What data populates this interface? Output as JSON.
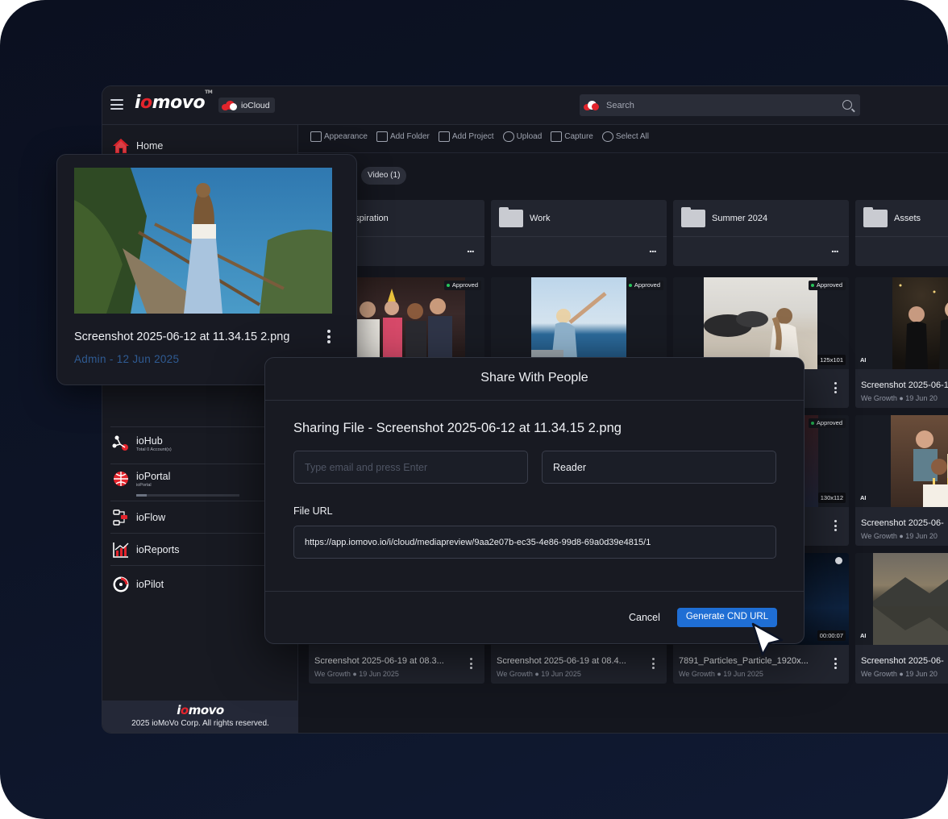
{
  "header": {
    "brand": "iomovo",
    "tm": "TM",
    "cloud_label": "ioCloud",
    "search_placeholder": "Search"
  },
  "sidebar": {
    "home": "Home",
    "items": [
      {
        "label": "ioHub",
        "sub": "Total 0 Account(s)"
      },
      {
        "label": "ioPortal",
        "sub": "ioPortal"
      },
      {
        "label": "ioFlow",
        "sub": ""
      },
      {
        "label": "ioReports",
        "sub": ""
      },
      {
        "label": "ioPilot",
        "sub": ""
      }
    ],
    "footer_brand": "iomovo",
    "copyright": "2025 ioMoVo Corp. All rights reserved."
  },
  "toolbar": [
    "Appearance",
    "Add Folder",
    "Add Project",
    "Upload",
    "Capture",
    "Select All"
  ],
  "filters": {
    "video": "Video (1)"
  },
  "folders": [
    "Inspiration",
    "Work",
    "Summer 2024",
    "Assets"
  ],
  "badge_approved": "Approved",
  "badge_ai": "AI",
  "cards": [
    {
      "title": "Screenshot 2025-06-19 at 08.3...",
      "owner": "We Growth",
      "date": "19 Jun 2025"
    },
    {
      "title": "Screenshot 2025-06-19 at 08.4...",
      "owner": "We Growth",
      "date": "19 Jun 2025"
    },
    {
      "title": "7891_Particles_Particle_1920x...",
      "owner": "We Growth",
      "date": "19 Jun 2025",
      "duration": "00:00:07"
    },
    {
      "title": "Screenshot 2025-06-1",
      "owner": "We Growth",
      "date": "19 Jun 20"
    },
    {
      "title": "Screenshot 2025-06-",
      "owner": "We Growth",
      "date": "19 Jun 20"
    },
    {
      "title": "Screenshot 2025-06-",
      "owner": "We Growth",
      "date": "19 Jun 20"
    }
  ],
  "dims": [
    "125x101",
    "130x112"
  ],
  "ellipsis": "...",
  "preview": {
    "filename": "Screenshot 2025-06-12 at 11.34.15 2.png",
    "owner": "Admin",
    "sep": "-",
    "date": "12 Jun 2025"
  },
  "modal": {
    "title": "Share With People",
    "subtitle": "Sharing File - Screenshot 2025-06-12 at 11.34.15 2.png",
    "email_placeholder": "Type email and press Enter",
    "role": "Reader",
    "url_label": "File URL",
    "url": "https://app.iomovo.io/i/cloud/mediapreview/9aa2e07b-ec35-4e86-99d8-69a0d39e4815/1",
    "cancel": "Cancel",
    "generate": "Generate CND URL"
  },
  "colors": {
    "accent": "#1f6ed4",
    "brand_red": "#e2242c",
    "approved": "#27c45a"
  }
}
